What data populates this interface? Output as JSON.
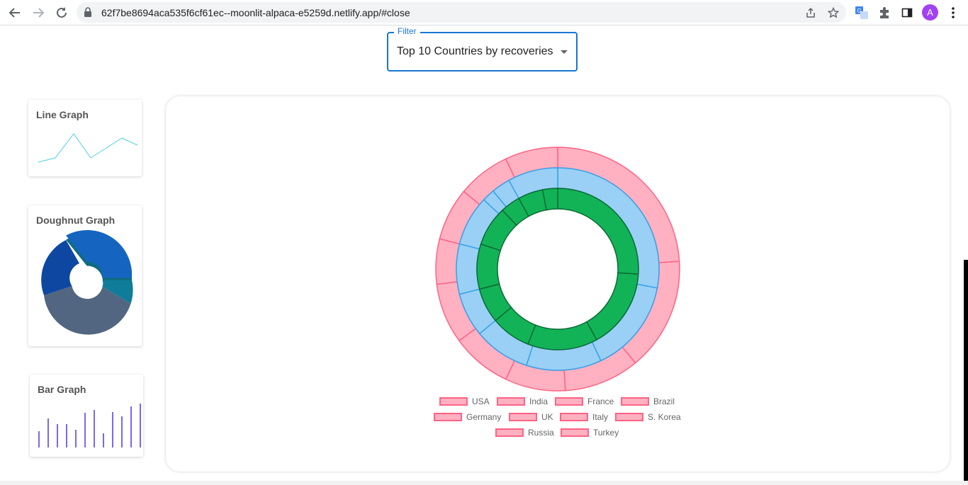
{
  "browser": {
    "url": "62f7be8694aca535f6cf61ec--moonlit-alpaca-e5259d.netlify.app/#close",
    "profile_initial": "A"
  },
  "filter": {
    "legend": "Filter",
    "value": "Top 10 Countries by recoveries"
  },
  "side_cards": {
    "line": {
      "title": "Line Graph"
    },
    "doughnut": {
      "title": "Doughnut Graph"
    },
    "bar": {
      "title": "Bar Graph"
    }
  },
  "colors": {
    "accent": "#1976d2",
    "pink": "#ff6384",
    "pink_fill": "#ffb1c1",
    "blue": "#36a2eb",
    "blue_fill": "#9ad0f5",
    "green": "#0f9d58",
    "green_fill": "#12b356"
  },
  "chart_data": {
    "type": "doughnut",
    "categories": [
      "USA",
      "India",
      "France",
      "Brazil",
      "Germany",
      "UK",
      "Italy",
      "S. Korea",
      "Russia",
      "Turkey"
    ],
    "series": [
      {
        "values": [
          24,
          15,
          10,
          8,
          8,
          8,
          6,
          7,
          7,
          7
        ]
      },
      {
        "values": [
          28,
          15,
          12,
          9,
          7,
          8,
          8,
          2,
          3,
          8
        ]
      },
      {
        "values": [
          26,
          16,
          14,
          8,
          7,
          9,
          8,
          4,
          5,
          3
        ]
      }
    ],
    "legend_position": "bottom"
  }
}
